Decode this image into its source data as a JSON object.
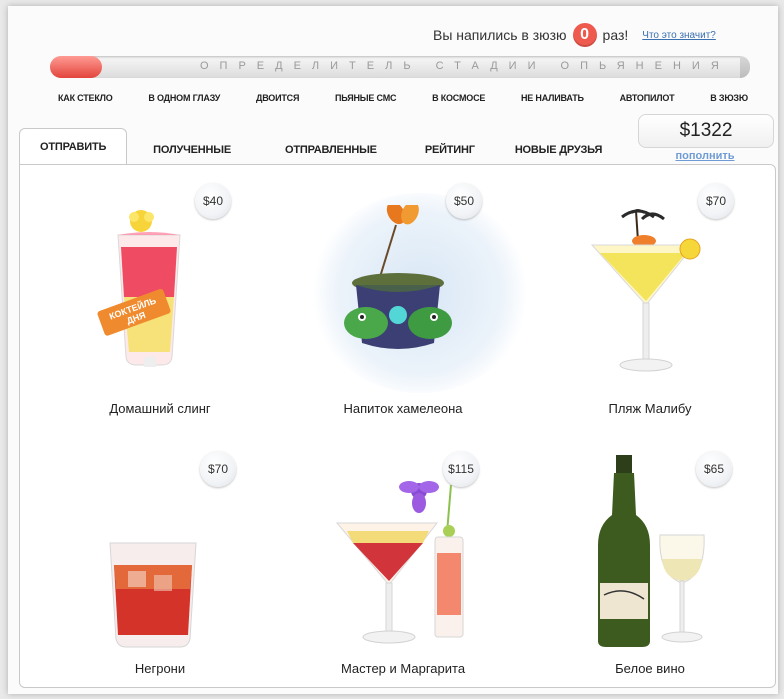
{
  "header": {
    "counter_prefix": "Вы напились в зюзю",
    "counter_value": "0",
    "counter_suffix": "раз!",
    "help_link": "Что это значит?"
  },
  "meter": {
    "caption": "ОПРЕДЕЛИТЕЛЬ СТАДИИ ОПЬЯНЕНИЯ",
    "stages": [
      "КАК СТЕКЛО",
      "В ОДНОМ ГЛАЗУ",
      "ДВОИТСЯ",
      "ПЬЯНЫЕ СМС",
      "В КОСМОСЕ",
      "НЕ НАЛИВАТЬ",
      "АВТОПИЛОТ",
      "В ЗЮЗЮ"
    ]
  },
  "tabs": {
    "send": "ОТПРАВИТЬ",
    "received": "ПОЛУЧЕННЫЕ",
    "sent": "ОТПРАВЛЕННЫЕ",
    "rating": "РЕЙТИНГ",
    "new_friends": "НОВЫЕ ДРУЗЬЯ"
  },
  "balance": {
    "amount": "$1322",
    "topup": "пополнить"
  },
  "drinks": [
    {
      "name": "Домашний слинг",
      "price": "$40",
      "badge": "КОКТЕЙЛЬ ДНЯ",
      "icon": "sling-glass-icon"
    },
    {
      "name": "Напиток хамелеона",
      "price": "$50",
      "icon": "chameleon-cup-icon"
    },
    {
      "name": "Пляж Малибу",
      "price": "$70",
      "icon": "martini-palm-icon"
    },
    {
      "name": "Негрони",
      "price": "$70",
      "icon": "tumbler-glass-icon"
    },
    {
      "name": "Мастер и Маргарита",
      "price": "$115",
      "icon": "martini-flower-icon"
    },
    {
      "name": "Белое вино",
      "price": "$65",
      "icon": "wine-bottle-icon"
    }
  ]
}
